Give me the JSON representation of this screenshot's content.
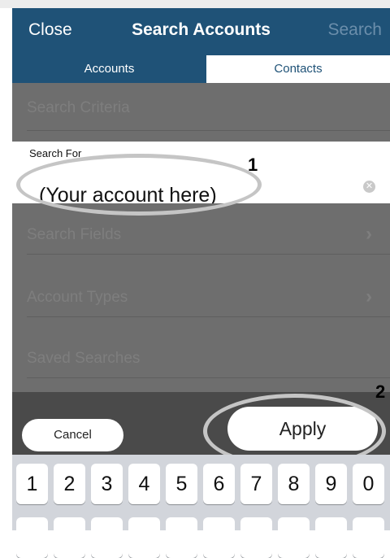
{
  "nav": {
    "close_label": "Close",
    "title": "Search Accounts",
    "search_label": "Search"
  },
  "segments": [
    {
      "label": "Accounts",
      "selected": true
    },
    {
      "label": "Contacts",
      "selected": false
    }
  ],
  "search_criteria_label": "Search Criteria",
  "search_for": {
    "label": "Search For",
    "value": "(Your account here)",
    "clear_icon": "clear-circle-icon"
  },
  "rows": [
    {
      "label": "Search Fields",
      "has_chevron": true
    },
    {
      "label": "Account Types",
      "has_chevron": true
    },
    {
      "label": "Saved Searches",
      "has_chevron": false
    }
  ],
  "callouts": {
    "one": "1",
    "two": "2"
  },
  "actions": {
    "cancel_label": "Cancel",
    "apply_label": "Apply"
  },
  "keyboard": {
    "number_keys": [
      "1",
      "2",
      "3",
      "4",
      "5",
      "6",
      "7",
      "8",
      "9",
      "0"
    ]
  },
  "colors": {
    "navbar": "#1f5277",
    "overlay": "#6e6e6e",
    "callout_ring": "#c5c5c5"
  }
}
